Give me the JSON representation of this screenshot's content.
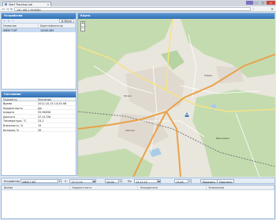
{
  "browser": {
    "tab_title": "Start Tracking Lab",
    "url": "192.168.1.39:8080",
    "window_controls": [
      "–",
      "□",
      "×"
    ]
  },
  "devices": {
    "header": "Устройства",
    "menu_label": "Меню",
    "columns": [
      "Название",
      "Идентификатор"
    ],
    "rows": [
      {
        "name": "iMEM T-MT",
        "id": "10041463"
      }
    ]
  },
  "map": {
    "header": "Карта",
    "labels": {
      "a": "Рясное",
      "b": "Озерки",
      "c": "Светлое",
      "d": "Ивантеевка"
    }
  },
  "state": {
    "header": "Состояние",
    "columns": [
      "Параметр",
      "Значение"
    ],
    "rows": [
      {
        "param": "Время",
        "value": "2012-10-15 14:25:08"
      },
      {
        "param": "Корректность",
        "value": "Да"
      },
      {
        "param": "Широта",
        "value": "55.96056"
      },
      {
        "param": "Долгота",
        "value": "37.21728"
      },
      {
        "param": "Температура, °C",
        "value": "23.2"
      },
      {
        "param": "Влажность, %",
        "value": "15"
      },
      {
        "param": "Батарея, %",
        "value": "39"
      }
    ]
  },
  "filter": {
    "device_label": "Устройство",
    "device_value": "iMEM T-MT",
    "from_label": "С",
    "from_date": "15.12.15",
    "from_time": "00:00",
    "to_label": "По",
    "to_date": "15.12.15",
    "to_time": "23:45",
    "show_button": "Показать",
    "clear_button": "Очистить"
  },
  "events": {
    "columns": [
      "Время",
      "Корректность",
      "Координаты",
      "Измерения"
    ]
  },
  "colors": {
    "header_blue": "#3f7fc1",
    "selection": "#c6dbf3",
    "forest": "#c4dbb0",
    "road_major": "#e8a24a",
    "road_yellow": "#f4e389"
  }
}
